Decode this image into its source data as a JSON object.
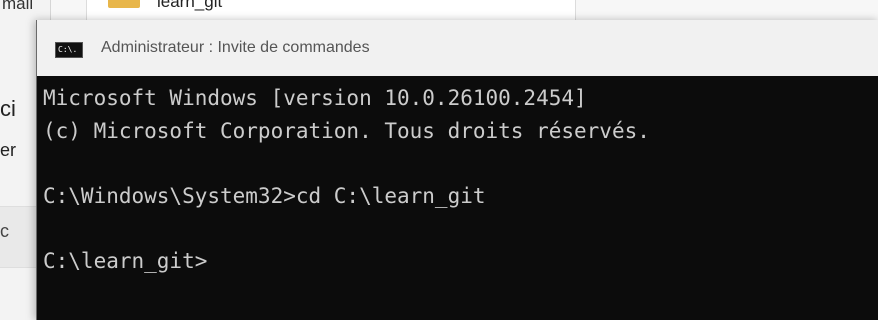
{
  "background": {
    "left_cell_text": "mail",
    "folder_label": "learn_git",
    "side_text_1": "ci",
    "side_text_2": "er",
    "side_text_3": "c"
  },
  "window": {
    "title": "Administrateur : Invite de commandes",
    "icon_label": "C:\\."
  },
  "console": {
    "lines": [
      "Microsoft Windows [version 10.0.26100.2454]",
      "(c) Microsoft Corporation. Tous droits réservés.",
      "C:\\Windows\\System32>cd C:\\learn_git",
      "C:\\learn_git>"
    ]
  },
  "colors": {
    "console_bg": "#0c0c0c",
    "console_text": "#cccccc",
    "titlebar_bg": "#f1f1f1"
  }
}
